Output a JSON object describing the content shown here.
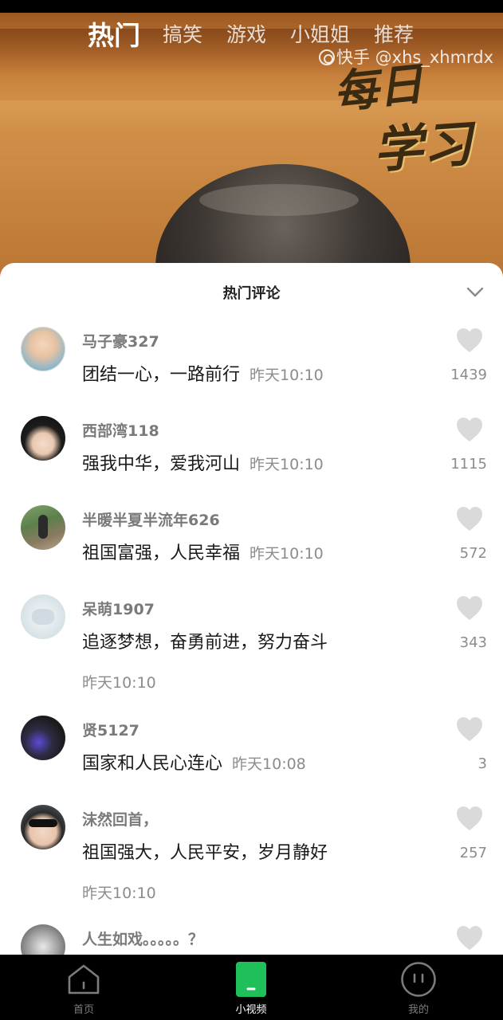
{
  "top_tabs": [
    {
      "label": "热门",
      "active": true
    },
    {
      "label": "搞笑",
      "active": false
    },
    {
      "label": "游戏",
      "active": false
    },
    {
      "label": "小姐姐",
      "active": false
    },
    {
      "label": "推荐",
      "active": false
    }
  ],
  "video": {
    "watermark": "快手 @xhs_xhmrdx",
    "calligraphy_line1": "每日",
    "calligraphy_line2": "学习"
  },
  "comments_panel": {
    "title": "热门评论",
    "collapse_icon": "chevron-down-icon",
    "comments": [
      {
        "user": "马子豪327",
        "text": "团结一心，一路前行",
        "time": "昨天10:10",
        "likes": "1439",
        "time_wrapped": false
      },
      {
        "user": "西部湾118",
        "text": "强我中华，爱我河山",
        "time": "昨天10:10",
        "likes": "1115",
        "time_wrapped": false
      },
      {
        "user": "半暖半夏半流年626",
        "text": "祖国富强，人民幸福",
        "time": "昨天10:10",
        "likes": "572",
        "time_wrapped": false
      },
      {
        "user": "呆萌1907",
        "text": "追逐梦想，奋勇前进，努力奋斗",
        "time": "昨天10:10",
        "likes": "343",
        "time_wrapped": true
      },
      {
        "user": "贤5127",
        "text": "国家和人民心连心",
        "time": "昨天10:08",
        "likes": "3",
        "time_wrapped": false
      },
      {
        "user": "沫然回首，",
        "text": "祖国强大，人民平安，岁月静好",
        "time": "昨天10:10",
        "likes": "257",
        "time_wrapped": true
      },
      {
        "user": "人生如戏。。。。。？",
        "text": "",
        "time": "",
        "likes": "",
        "time_wrapped": false
      }
    ]
  },
  "bottom_nav": [
    {
      "label": "首页",
      "icon": "home-icon",
      "active": false
    },
    {
      "label": "小视频",
      "icon": "short-video-icon",
      "active": true
    },
    {
      "label": "我的",
      "icon": "profile-icon",
      "active": false
    }
  ],
  "colors": {
    "accent_green": "#1fc05a",
    "sheet_bg": "#ffffff",
    "nav_bg": "#000000",
    "like_icon": "#d9d9d9"
  }
}
